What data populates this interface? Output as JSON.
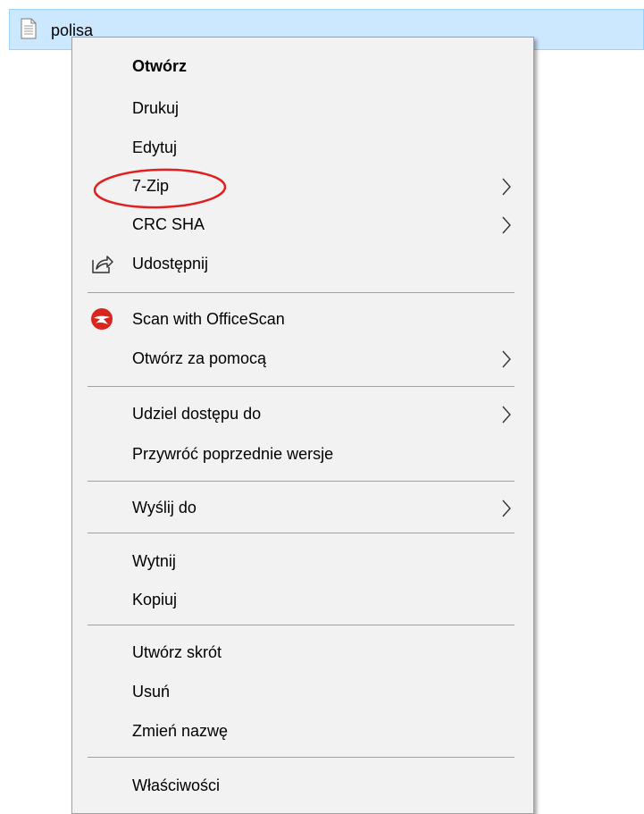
{
  "file": {
    "name": "polisa",
    "icon": "text-document-icon"
  },
  "menu": {
    "items": [
      {
        "id": "open",
        "label": "Otwórz",
        "bold": true
      },
      {
        "id": "print",
        "label": "Drukuj"
      },
      {
        "id": "edit",
        "label": "Edytuj"
      },
      {
        "id": "7zip",
        "label": "7-Zip",
        "submenu": true,
        "highlighted": true
      },
      {
        "id": "crc-sha",
        "label": "CRC SHA",
        "submenu": true
      },
      {
        "id": "share",
        "label": "Udostępnij",
        "icon": "share-icon"
      },
      {
        "id": "scan",
        "label": "Scan with OfficeScan",
        "icon": "officescan-icon"
      },
      {
        "id": "open-with",
        "label": "Otwórz za pomocą",
        "submenu": true
      },
      {
        "id": "give-access",
        "label": "Udziel dostępu do",
        "submenu": true
      },
      {
        "id": "restore-versions",
        "label": "Przywróć poprzednie wersje"
      },
      {
        "id": "send-to",
        "label": "Wyślij do",
        "submenu": true
      },
      {
        "id": "cut",
        "label": "Wytnij"
      },
      {
        "id": "copy",
        "label": "Kopiuj"
      },
      {
        "id": "create-shortcut",
        "label": "Utwórz skrót"
      },
      {
        "id": "delete",
        "label": "Usuń"
      },
      {
        "id": "rename",
        "label": "Zmień nazwę"
      },
      {
        "id": "properties",
        "label": "Właściwości"
      }
    ]
  },
  "colors": {
    "selection_fill": "#cce8ff",
    "selection_border": "#99d1ff",
    "menu_background": "#f2f2f2",
    "highlight_circle": "#e02020",
    "scan_icon": "#d9261c"
  }
}
